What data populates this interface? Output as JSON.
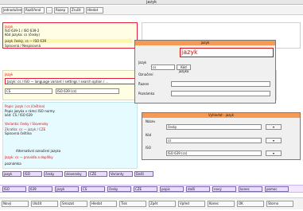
{
  "window": {
    "title": "jazyk"
  },
  "toolbar": {
    "buttons": [
      "Jednodušené",
      "Rozšířené",
      "...",
      "Rozep",
      "Zrušit",
      "Hledat"
    ]
  },
  "top_pane": {
    "lines": [
      "Jazyk",
      "ISO 639-1 / ISO 639-2",
      "Kód jazyka: cs (česky)",
      "jazyk český, cs — ISO 639",
      "Spisovná / Nespisovná"
    ]
  },
  "main_pane": {
    "label": "Jazyk",
    "highlight_line": "Jazyk: cs / ISO — language variant / settings / search option / …",
    "field1": "CS",
    "field2": "ISO 639 (cs)"
  },
  "lower_pane": {
    "heading": "Popis: jazyk / cs (čeština)",
    "lines": [
      "Popis jazyka v rámci ISO normy",
      "kód: CS / ISO 639",
      "Varianta: česky / Slovensky",
      "Zkratka: cs — jazyk / CZE",
      "Spisovná čeština",
      "Alternativní označení jazyka",
      "Jazyk: cs — pravidla a doplňky",
      "poznámka"
    ]
  },
  "dialog_main": {
    "title": "jazyk",
    "name_value": "jazyk",
    "rows": [
      "Jazyk",
      "Kód jazyka",
      "Označení",
      "Řazení",
      "Poznámka"
    ],
    "select_value": "cs"
  },
  "dialog_secondary": {
    "title": "Vyhledat - jazyk",
    "fields": [
      {
        "label": "Název",
        "value": "česky"
      },
      {
        "label": "Kód",
        "value": "cs"
      },
      {
        "label": "ISO",
        "value": "ISO 639 (cs)"
      }
    ]
  },
  "tabs": [
    "jazyk",
    "ISO",
    "česky",
    "slovensky",
    "CZE",
    "Varianty",
    "Další"
  ],
  "bottom_tabs": [
    "ISO",
    "639",
    "jazyk",
    "CS",
    "česky",
    "CZE",
    "popis",
    "další",
    "nový",
    "konec",
    "pomoc"
  ],
  "statusbar": [
    "Nový",
    "Uložit",
    "Smazat",
    "Hledat",
    "Tisk",
    "Zpět",
    "Vpřed",
    "Konec",
    "OK",
    "Storno"
  ]
}
